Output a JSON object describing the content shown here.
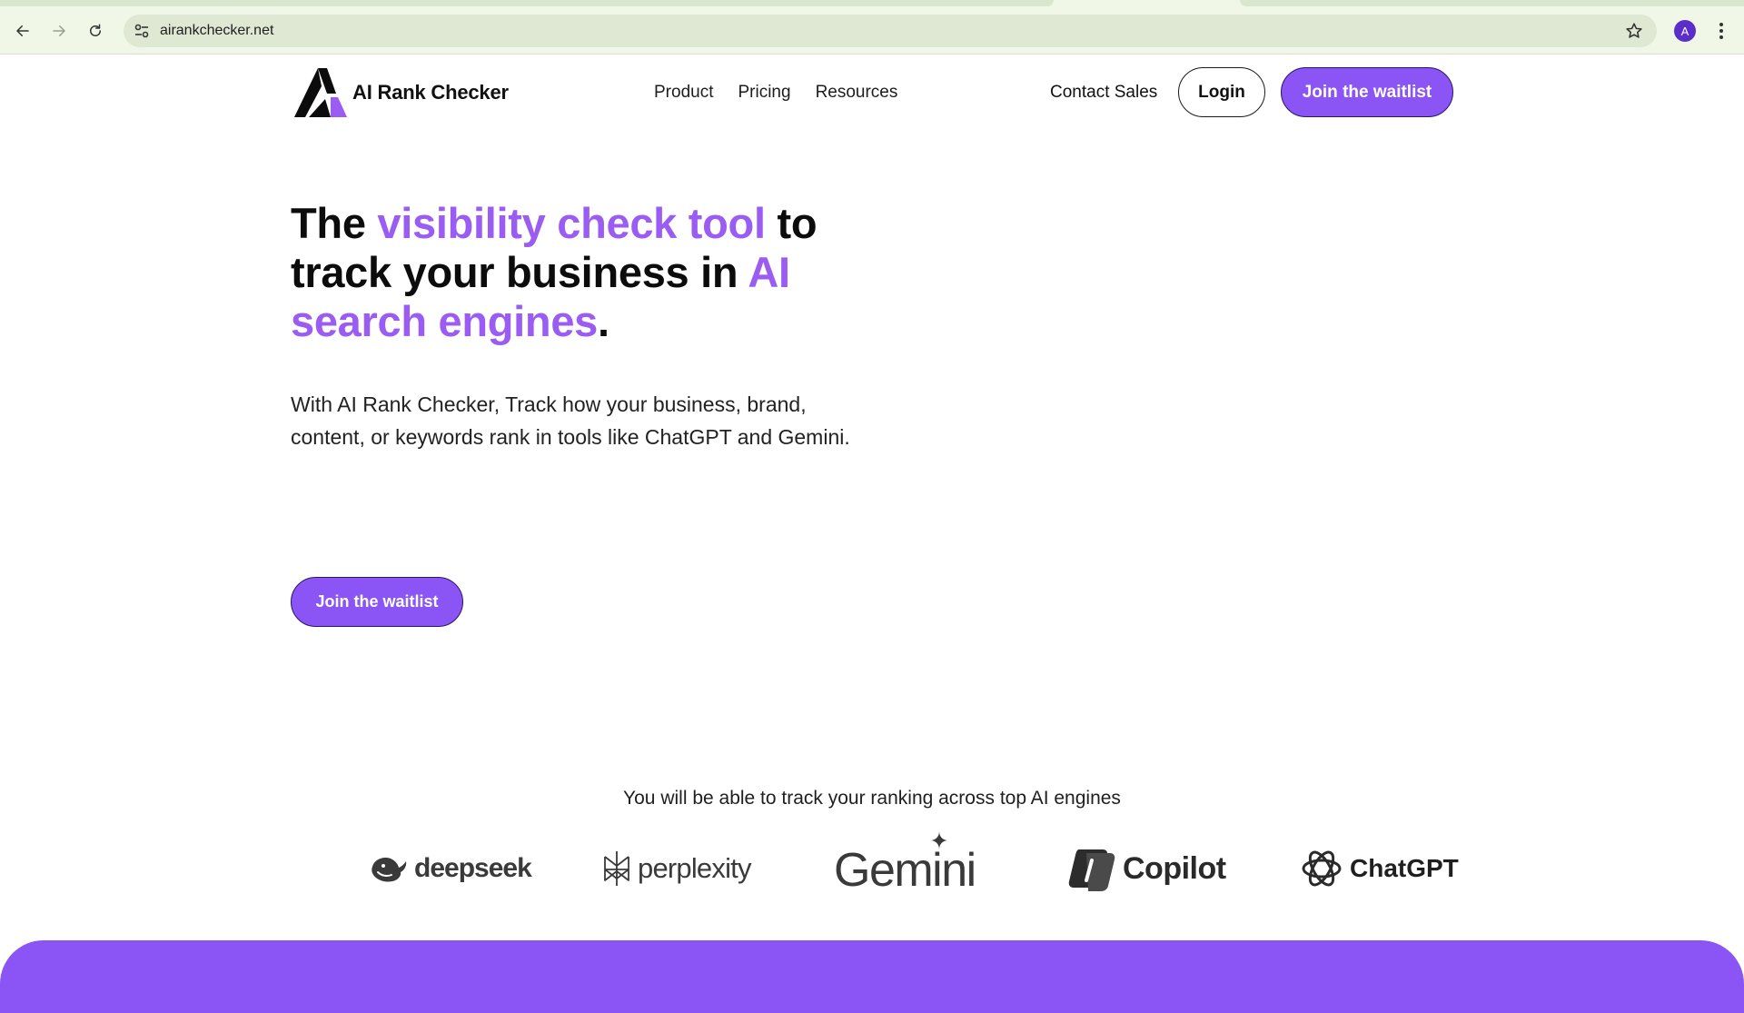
{
  "browser": {
    "url": "airankchecker.net",
    "profile_initial": "A"
  },
  "header": {
    "brand": "AI Rank Checker",
    "nav": [
      "Product",
      "Pricing",
      "Resources"
    ],
    "contact": "Contact Sales",
    "login": "Login",
    "cta": "Join the waitlist"
  },
  "hero": {
    "title_part1": "The ",
    "title_accent1": "visibility check tool",
    "title_part2": " to track your business in ",
    "title_accent2": "AI search engines",
    "title_end": ".",
    "description": "With AI Rank Checker, Track how your business, brand, content, or keywords rank in tools like ChatGPT and Gemini.",
    "cta": "Join the waitlist"
  },
  "engines": {
    "caption": "You will be able to track your ranking across top AI engines",
    "items": [
      "deepseek",
      "perplexity",
      "Gemini",
      "Copilot",
      "ChatGPT"
    ]
  },
  "colors": {
    "accent": "#9a5cf3",
    "button": "#8b55f5",
    "chrome": "#f1f7e6"
  }
}
